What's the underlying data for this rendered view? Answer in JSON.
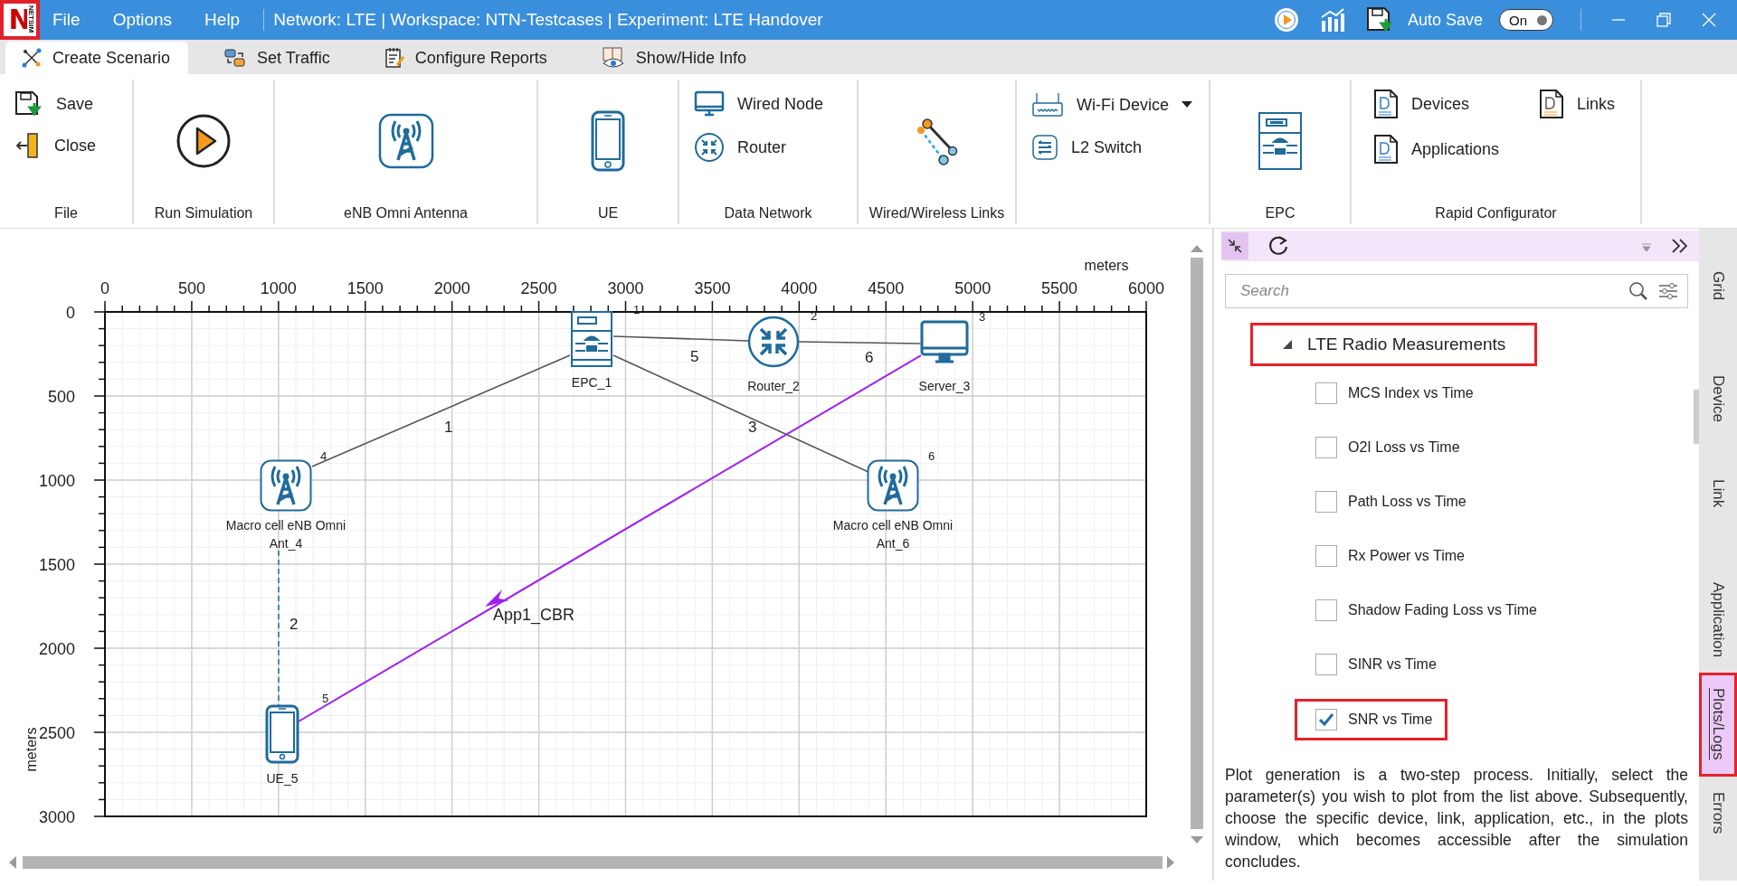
{
  "logo": {
    "letter": "N",
    "subtitle": "NETSIM"
  },
  "menu": [
    "File",
    "Options",
    "Help"
  ],
  "title": "Network: LTE | Workspace: NTN-Testcases | Experiment: LTE Handover",
  "auto_save": {
    "label": "Auto Save",
    "toggle_text": "On",
    "on": true
  },
  "tabs": [
    {
      "label": "Create Scenario",
      "selected": true
    },
    {
      "label": "Set Traffic",
      "selected": false
    },
    {
      "label": "Configure Reports",
      "selected": false
    },
    {
      "label": "Show/Hide Info",
      "selected": false
    }
  ],
  "ribbon": [
    {
      "label": "File",
      "items": [
        {
          "kind": "small",
          "label": "Save"
        },
        {
          "kind": "small",
          "label": "Close"
        }
      ]
    },
    {
      "label": "Run Simulation",
      "items": [
        {
          "kind": "large"
        }
      ]
    },
    {
      "label": "eNB Omni Antenna",
      "items": [
        {
          "kind": "large"
        }
      ]
    },
    {
      "label": "UE",
      "items": [
        {
          "kind": "large"
        }
      ]
    },
    {
      "label": "Data Network",
      "items": [
        {
          "kind": "small",
          "label": "Wired Node"
        },
        {
          "kind": "small",
          "label": "Router"
        }
      ]
    },
    {
      "label": "Wired/Wireless Links",
      "items": [
        {
          "kind": "large"
        }
      ]
    },
    {
      "items": [
        {
          "kind": "dropdown",
          "label": "Wi-Fi Device"
        },
        {
          "kind": "small",
          "label": "L2 Switch"
        }
      ]
    },
    {
      "label": "EPC",
      "items": [
        {
          "kind": "large"
        }
      ]
    },
    {
      "label": "Rapid Configurator",
      "items": [
        {
          "kind": "small",
          "label": "Devices"
        },
        {
          "kind": "small",
          "label": "Links"
        },
        {
          "kind": "small",
          "label": "Applications"
        }
      ]
    }
  ],
  "canvas": {
    "x_unit": "meters",
    "y_unit": "meters",
    "x_ticks": [
      "0",
      "500",
      "1000",
      "1500",
      "2000",
      "2500",
      "3000",
      "3500",
      "4000",
      "4500",
      "5000",
      "5500",
      "6000"
    ],
    "y_ticks": [
      "0",
      "500",
      "1000",
      "1500",
      "2000",
      "2500",
      "3000"
    ],
    "nodes": [
      {
        "kind": "epc",
        "name": "EPC_1",
        "number": "1"
      },
      {
        "kind": "router",
        "name": "Router_2",
        "number": "2"
      },
      {
        "kind": "server",
        "name": "Server_3",
        "number": "3"
      },
      {
        "kind": "antenna",
        "name": "Macro cell eNB Omni Ant_4",
        "number": "4"
      },
      {
        "kind": "ue",
        "name": "UE_5",
        "number": "5"
      },
      {
        "kind": "antenna",
        "name": "Macro cell eNB Omni Ant_6",
        "number": "6"
      }
    ],
    "links": [
      {
        "kind": "wired",
        "label": "1"
      },
      {
        "kind": "wireless",
        "label": "2"
      },
      {
        "kind": "wired",
        "label": "3"
      },
      {
        "kind": "wired",
        "label": "5"
      },
      {
        "kind": "wired",
        "label": "6"
      }
    ],
    "application": "App1_CBR"
  },
  "panel": {
    "search_placeholder": "Search",
    "group": {
      "label": "LTE Radio Measurements",
      "expanded": true,
      "highlighted": true
    },
    "items": [
      {
        "label": "MCS Index vs Time",
        "checked": false,
        "highlighted": false
      },
      {
        "label": "O2I Loss vs Time",
        "checked": false,
        "highlighted": false
      },
      {
        "label": "Path Loss vs Time",
        "checked": false,
        "highlighted": false
      },
      {
        "label": "Rx Power vs Time",
        "checked": false,
        "highlighted": false
      },
      {
        "label": "Shadow Fading Loss vs Time",
        "checked": false,
        "highlighted": false
      },
      {
        "label": "SINR vs Time",
        "checked": false,
        "highlighted": false
      },
      {
        "label": "SNR vs Time",
        "checked": true,
        "highlighted": true
      }
    ],
    "description": "Plot generation is a two-step process. Initially, select the parameter(s) you wish to plot from the list above. Subsequently, choose the specific device, link, application, etc., in the plots window, which becomes accessible after the simulation concludes."
  },
  "side_tabs": [
    {
      "label": "Grid",
      "selected": false,
      "highlighted": false
    },
    {
      "label": "Device",
      "selected": false,
      "highlighted": false
    },
    {
      "label": "Link",
      "selected": false,
      "highlighted": false
    },
    {
      "label": "Application",
      "selected": false,
      "highlighted": false
    },
    {
      "label": "Plots/Logs",
      "selected": true,
      "highlighted": true
    },
    {
      "label": "Errors",
      "selected": false,
      "highlighted": false
    }
  ]
}
